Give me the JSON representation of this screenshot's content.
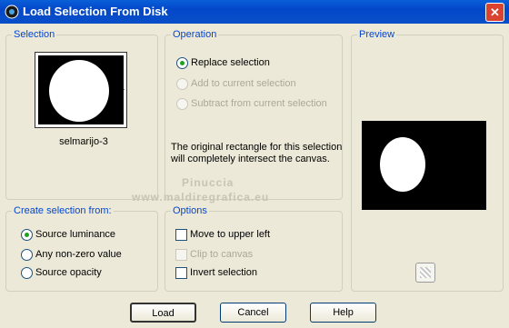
{
  "title": "Load Selection From Disk",
  "icons": {
    "app": "psp-icon",
    "close": "close-icon"
  },
  "selection": {
    "legend": "Selection",
    "name": "selmarijo-3"
  },
  "operation": {
    "legend": "Operation",
    "options": [
      {
        "label": "Replace selection",
        "selected": true,
        "enabled": true
      },
      {
        "label": "Add to current selection",
        "selected": false,
        "enabled": false
      },
      {
        "label": "Subtract from current selection",
        "selected": false,
        "enabled": false
      }
    ],
    "note": "The original rectangle for this selection will completely intersect the canvas."
  },
  "preview": {
    "legend": "Preview"
  },
  "create_from": {
    "legend": "Create selection from:",
    "options": [
      {
        "label": "Source luminance",
        "selected": true
      },
      {
        "label": "Any non-zero value",
        "selected": false
      },
      {
        "label": "Source opacity",
        "selected": false
      }
    ]
  },
  "options": {
    "legend": "Options",
    "items": [
      {
        "label": "Move to upper left",
        "checked": false,
        "enabled": true
      },
      {
        "label": "Clip to canvas",
        "checked": false,
        "enabled": false
      },
      {
        "label": "Invert selection",
        "checked": false,
        "enabled": true
      }
    ]
  },
  "watermark": {
    "line1": "Pinuccia",
    "line2": "www.maldiregrafica.eu"
  },
  "buttons": {
    "load": "Load",
    "cancel": "Cancel",
    "help": "Help"
  },
  "colors": {
    "title_bar": "#0a4fc8",
    "group_legend": "#0046d5",
    "dialog_bg": "#ece9d8",
    "radio_dot": "#21a121"
  }
}
